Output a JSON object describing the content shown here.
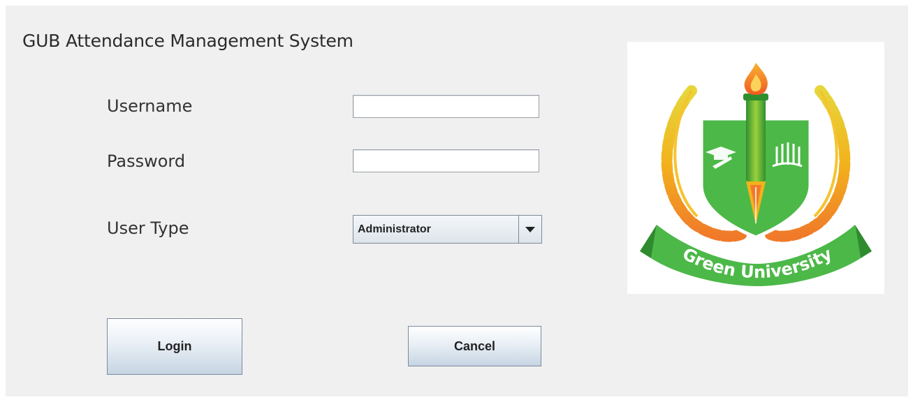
{
  "app": {
    "title": "GUB Attendance Management System"
  },
  "form": {
    "username_label": "Username",
    "username_value": "",
    "password_label": "Password",
    "password_value": "",
    "usertype_label": "User Type",
    "usertype_selected": "Administrator"
  },
  "buttons": {
    "login": "Login",
    "cancel": "Cancel"
  },
  "logo": {
    "text": "Green University",
    "colors": {
      "green": "#4cb848",
      "dark_green": "#2e8b2e",
      "gold": "#f2b21c",
      "orange": "#f26b1f"
    }
  }
}
